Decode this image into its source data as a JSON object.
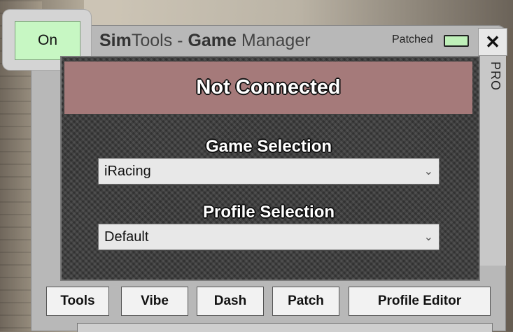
{
  "app": {
    "title_brand_bold": "Sim",
    "title_brand_light": "Tools",
    "title_sep": " - ",
    "title_bold": "Game",
    "title_light": " Manager",
    "close_label": "✕"
  },
  "power": {
    "label": "On"
  },
  "patch_status": {
    "label": "Patched",
    "led_color": "#bff0b9"
  },
  "edition": {
    "label": "PRO"
  },
  "connection": {
    "status": "Not Connected",
    "status_color": "#a57a7a"
  },
  "game_selection": {
    "label": "Game Selection",
    "value": "iRacing"
  },
  "profile_selection": {
    "label": "Profile Selection",
    "value": "Default"
  },
  "buttons": [
    {
      "label": "Tools"
    },
    {
      "label": "Vibe"
    },
    {
      "label": "Dash"
    },
    {
      "label": "Patch"
    },
    {
      "label": "Profile Editor"
    }
  ],
  "icons": {
    "dropdown": "chevron-down-icon",
    "close": "close-icon"
  }
}
